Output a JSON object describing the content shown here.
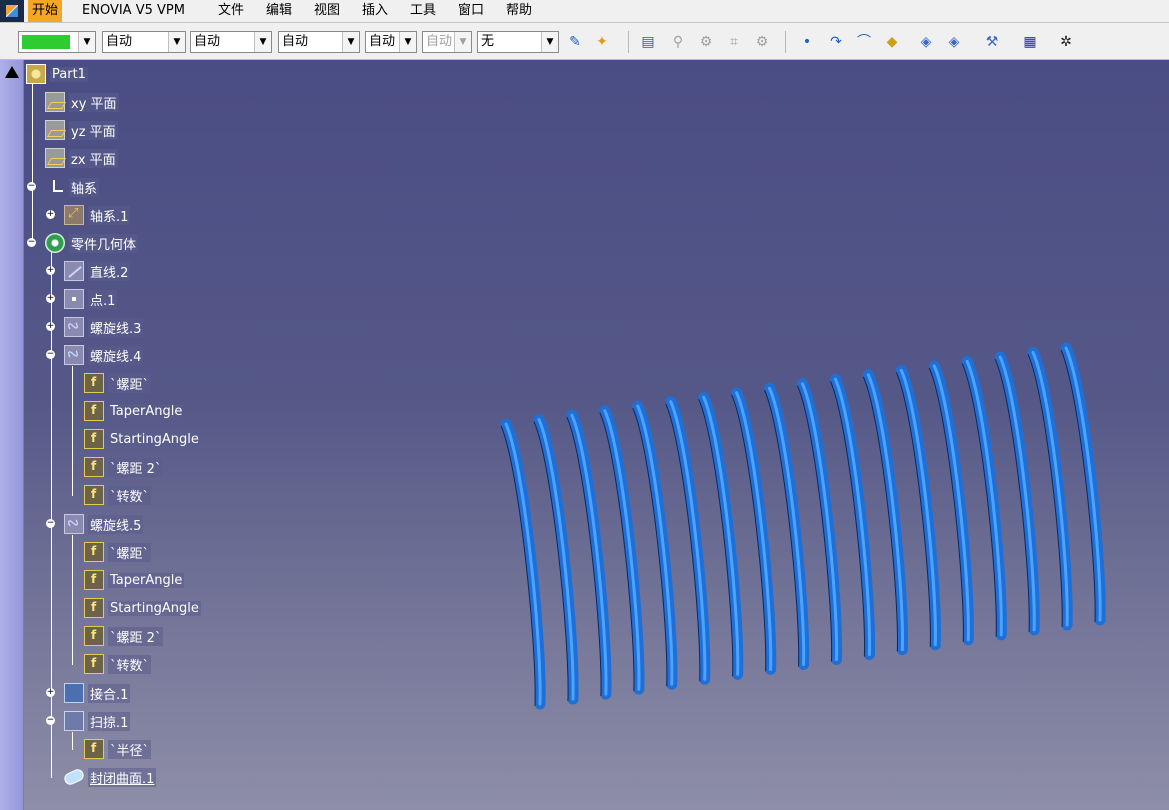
{
  "menu": {
    "items": [
      "开始",
      "ENOVIA V5 VPM",
      "文件",
      "编辑",
      "视图",
      "插入",
      "工具",
      "窗口",
      "帮助"
    ]
  },
  "toolbar": {
    "color_swatch": "#2ecc2e",
    "combos": [
      "自动",
      "自动",
      "自动",
      "自动",
      "自动",
      "无"
    ],
    "combo_arrow": "▼",
    "icons": [
      "paintbrush-icon",
      "wand-icon",
      "properties-icon",
      "measure-icon",
      "analysis-icon",
      "grid-icon",
      "settings-icon",
      "point-icon",
      "curve-icon",
      "surface-icon",
      "fill-icon",
      "solid-icon",
      "join-icon",
      "tools-icon",
      "catalog-icon",
      "compass-icon"
    ]
  },
  "tree": {
    "root": "Part1",
    "planes": [
      "xy 平面",
      "yz 平面",
      "zx 平面"
    ],
    "axis_system": "轴系",
    "axis_item": "轴系.1",
    "geometry_set": "零件几何体",
    "line": "直线.2",
    "point": "点.1",
    "helix3": "螺旋线.3",
    "helix4": "螺旋线.4",
    "helix4_params": [
      "`螺距`",
      "TaperAngle",
      "StartingAngle",
      "`螺距 2`",
      "`转数`"
    ],
    "helix5": "螺旋线.5",
    "helix5_params": [
      "`螺距`",
      "TaperAngle",
      "StartingAngle",
      "`螺距 2`",
      "`转数`"
    ],
    "join": "接合.1",
    "sweep": "扫掠.1",
    "sweep_param": "`半径`",
    "closed_surface": "封闭曲面.1"
  },
  "viewport": {
    "background_top": "#4a4d84",
    "background_bottom": "#8e8ea8",
    "spring_color": "#1f6fd6",
    "spring_coil_count": 18
  }
}
